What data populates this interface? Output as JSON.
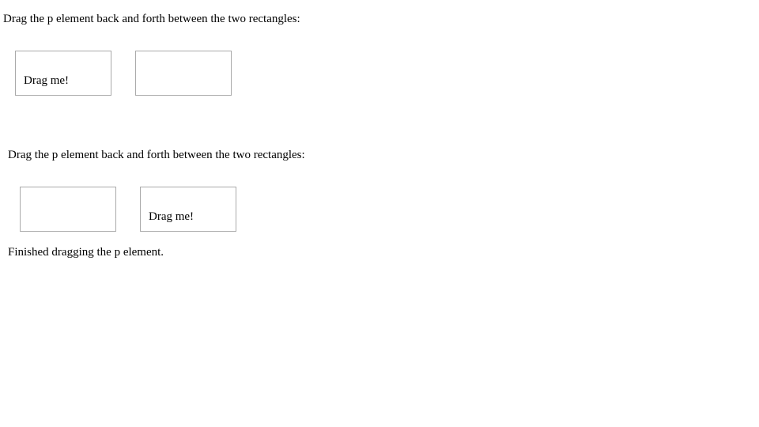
{
  "demo_1": {
    "instruction": "Drag the p element back and forth between the two rectangles:",
    "drag_item_label": "Drag me!"
  },
  "demo_2": {
    "instruction": "Drag the p element back and forth between the two rectangles:",
    "drag_item_label": "Drag me!",
    "status": "Finished dragging the p element."
  }
}
